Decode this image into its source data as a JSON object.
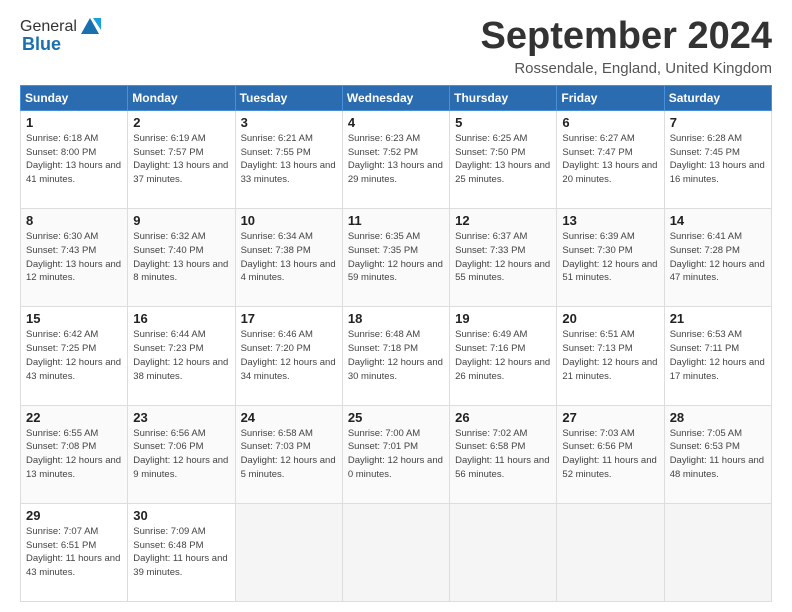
{
  "header": {
    "logo_general": "General",
    "logo_blue": "Blue",
    "month_title": "September 2024",
    "location": "Rossendale, England, United Kingdom"
  },
  "days_of_week": [
    "Sunday",
    "Monday",
    "Tuesday",
    "Wednesday",
    "Thursday",
    "Friday",
    "Saturday"
  ],
  "weeks": [
    [
      {
        "day": "1",
        "sunrise": "6:18 AM",
        "sunset": "8:00 PM",
        "daylight": "13 hours and 41 minutes."
      },
      {
        "day": "2",
        "sunrise": "6:19 AM",
        "sunset": "7:57 PM",
        "daylight": "13 hours and 37 minutes."
      },
      {
        "day": "3",
        "sunrise": "6:21 AM",
        "sunset": "7:55 PM",
        "daylight": "13 hours and 33 minutes."
      },
      {
        "day": "4",
        "sunrise": "6:23 AM",
        "sunset": "7:52 PM",
        "daylight": "13 hours and 29 minutes."
      },
      {
        "day": "5",
        "sunrise": "6:25 AM",
        "sunset": "7:50 PM",
        "daylight": "13 hours and 25 minutes."
      },
      {
        "day": "6",
        "sunrise": "6:27 AM",
        "sunset": "7:47 PM",
        "daylight": "13 hours and 20 minutes."
      },
      {
        "day": "7",
        "sunrise": "6:28 AM",
        "sunset": "7:45 PM",
        "daylight": "13 hours and 16 minutes."
      }
    ],
    [
      {
        "day": "8",
        "sunrise": "6:30 AM",
        "sunset": "7:43 PM",
        "daylight": "13 hours and 12 minutes."
      },
      {
        "day": "9",
        "sunrise": "6:32 AM",
        "sunset": "7:40 PM",
        "daylight": "13 hours and 8 minutes."
      },
      {
        "day": "10",
        "sunrise": "6:34 AM",
        "sunset": "7:38 PM",
        "daylight": "13 hours and 4 minutes."
      },
      {
        "day": "11",
        "sunrise": "6:35 AM",
        "sunset": "7:35 PM",
        "daylight": "12 hours and 59 minutes."
      },
      {
        "day": "12",
        "sunrise": "6:37 AM",
        "sunset": "7:33 PM",
        "daylight": "12 hours and 55 minutes."
      },
      {
        "day": "13",
        "sunrise": "6:39 AM",
        "sunset": "7:30 PM",
        "daylight": "12 hours and 51 minutes."
      },
      {
        "day": "14",
        "sunrise": "6:41 AM",
        "sunset": "7:28 PM",
        "daylight": "12 hours and 47 minutes."
      }
    ],
    [
      {
        "day": "15",
        "sunrise": "6:42 AM",
        "sunset": "7:25 PM",
        "daylight": "12 hours and 43 minutes."
      },
      {
        "day": "16",
        "sunrise": "6:44 AM",
        "sunset": "7:23 PM",
        "daylight": "12 hours and 38 minutes."
      },
      {
        "day": "17",
        "sunrise": "6:46 AM",
        "sunset": "7:20 PM",
        "daylight": "12 hours and 34 minutes."
      },
      {
        "day": "18",
        "sunrise": "6:48 AM",
        "sunset": "7:18 PM",
        "daylight": "12 hours and 30 minutes."
      },
      {
        "day": "19",
        "sunrise": "6:49 AM",
        "sunset": "7:16 PM",
        "daylight": "12 hours and 26 minutes."
      },
      {
        "day": "20",
        "sunrise": "6:51 AM",
        "sunset": "7:13 PM",
        "daylight": "12 hours and 21 minutes."
      },
      {
        "day": "21",
        "sunrise": "6:53 AM",
        "sunset": "7:11 PM",
        "daylight": "12 hours and 17 minutes."
      }
    ],
    [
      {
        "day": "22",
        "sunrise": "6:55 AM",
        "sunset": "7:08 PM",
        "daylight": "12 hours and 13 minutes."
      },
      {
        "day": "23",
        "sunrise": "6:56 AM",
        "sunset": "7:06 PM",
        "daylight": "12 hours and 9 minutes."
      },
      {
        "day": "24",
        "sunrise": "6:58 AM",
        "sunset": "7:03 PM",
        "daylight": "12 hours and 5 minutes."
      },
      {
        "day": "25",
        "sunrise": "7:00 AM",
        "sunset": "7:01 PM",
        "daylight": "12 hours and 0 minutes."
      },
      {
        "day": "26",
        "sunrise": "7:02 AM",
        "sunset": "6:58 PM",
        "daylight": "11 hours and 56 minutes."
      },
      {
        "day": "27",
        "sunrise": "7:03 AM",
        "sunset": "6:56 PM",
        "daylight": "11 hours and 52 minutes."
      },
      {
        "day": "28",
        "sunrise": "7:05 AM",
        "sunset": "6:53 PM",
        "daylight": "11 hours and 48 minutes."
      }
    ],
    [
      {
        "day": "29",
        "sunrise": "7:07 AM",
        "sunset": "6:51 PM",
        "daylight": "11 hours and 43 minutes."
      },
      {
        "day": "30",
        "sunrise": "7:09 AM",
        "sunset": "6:48 PM",
        "daylight": "11 hours and 39 minutes."
      },
      null,
      null,
      null,
      null,
      null
    ]
  ]
}
